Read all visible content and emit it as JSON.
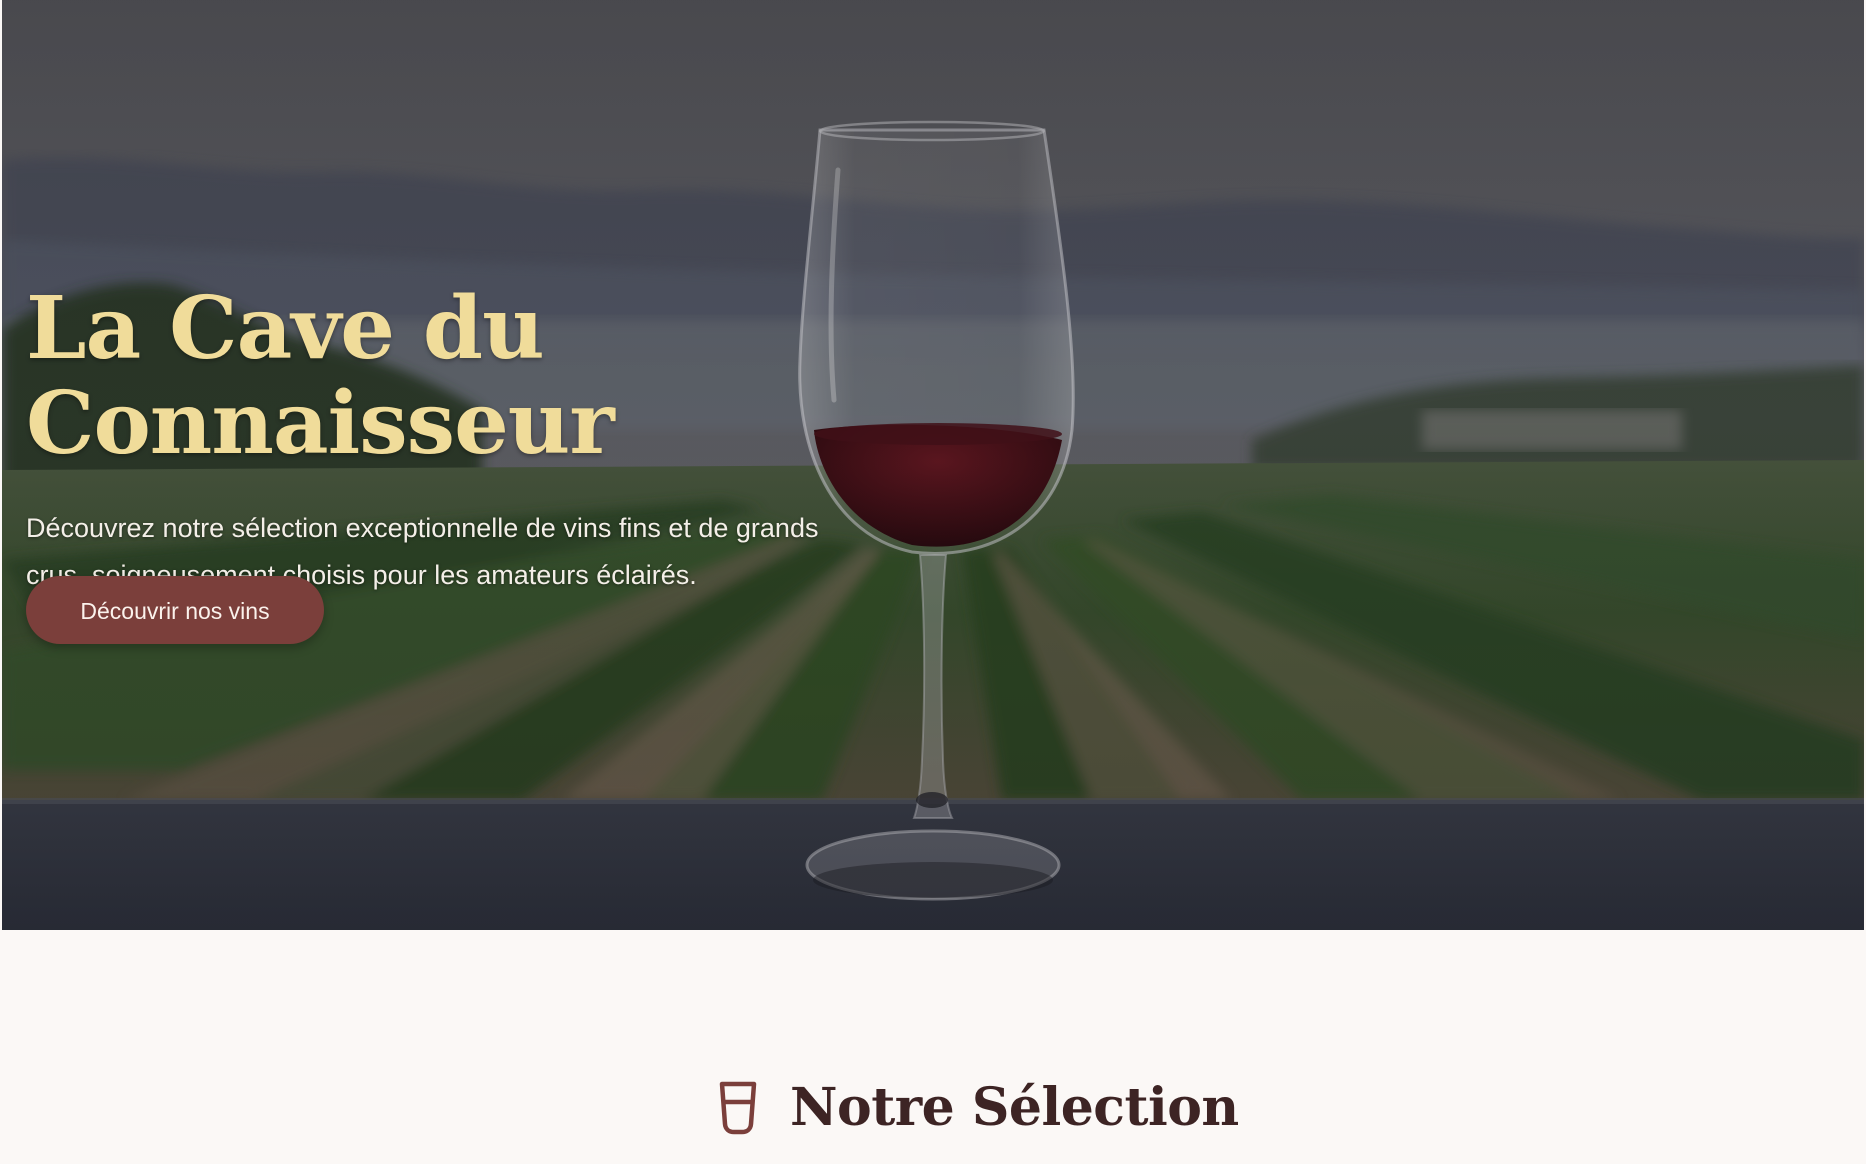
{
  "hero": {
    "title": "La Cave du Connaisseur",
    "subtitle_line_1": "Découvrez notre sélection exceptionnelle de vins fins et de grands",
    "subtitle_line_2": "crus, soigneusement choisis pour les amateurs éclairés.",
    "cta_label": "Découvrir nos vins",
    "background_image": "vineyard-wine-glass-photo"
  },
  "selection": {
    "title": "Notre Sélection",
    "icon": "wine-glass-icon"
  },
  "colors": {
    "title_gold": "#f0dc9a",
    "button_burgundy": "#7b3f3b",
    "section_background": "#fbf8f6",
    "section_title": "#3d2424",
    "icon_accent": "#7b3f3b"
  }
}
